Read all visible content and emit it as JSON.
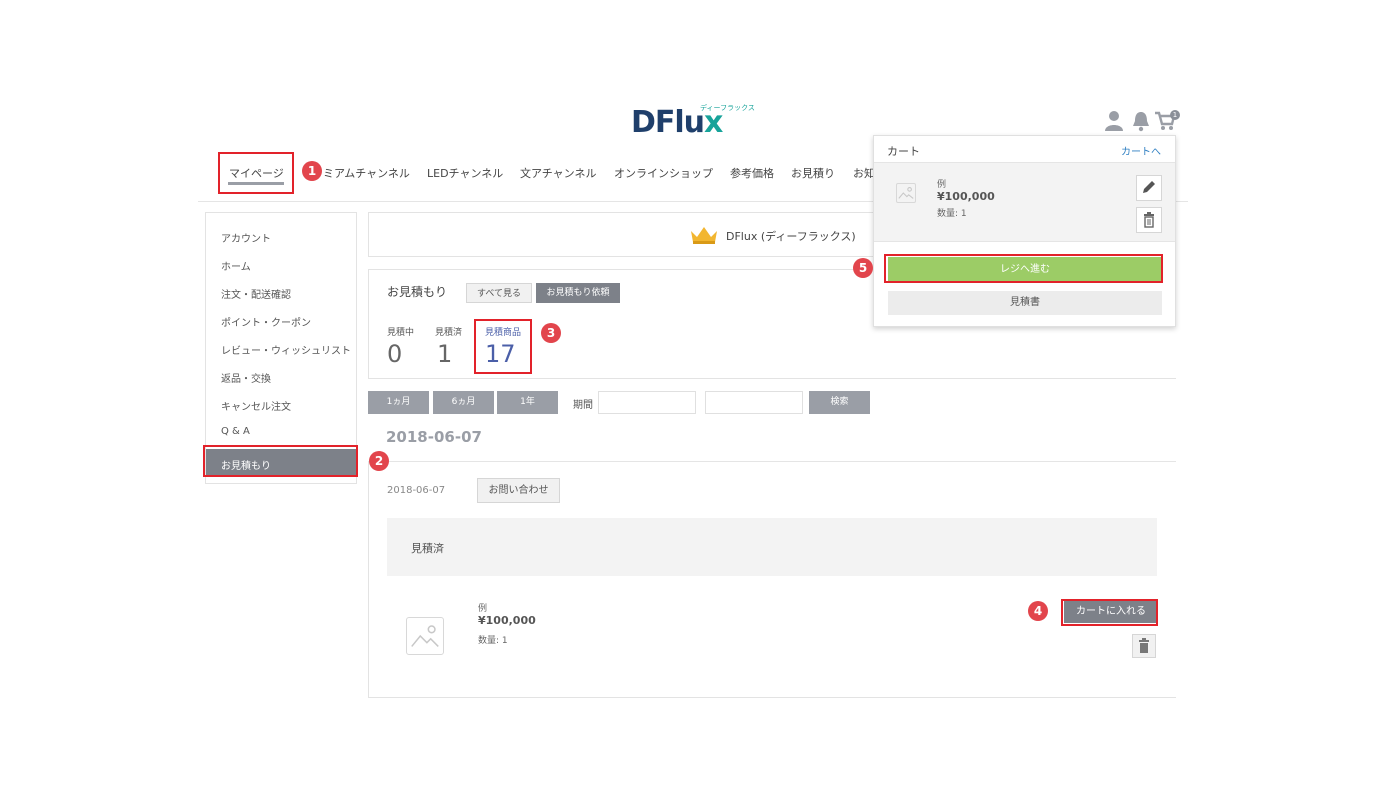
{
  "header": {
    "logo_text_main": "DFlu",
    "logo_text_x": "x",
    "logo_sub": "ディーフラックス",
    "cart_count": "1",
    "icons": [
      "user-icon",
      "bell-icon",
      "cart-icon"
    ]
  },
  "nav": {
    "items": [
      "マイページ",
      "ミアムチャンネル",
      "LEDチャンネル",
      "文アチャンネル",
      "オンラインショップ",
      "参考価格",
      "お見積り",
      "お知"
    ],
    "active": "マイページ"
  },
  "sidebar": {
    "items": [
      "アカウント",
      "ホーム",
      "注文・配送確認",
      "ポイント・クーポン",
      "レビュー・ウィッシュリスト",
      "返品・交換",
      "キャンセル注文",
      "Q & A"
    ],
    "active": "お見積もり"
  },
  "member": {
    "name": "DFlux (ディーフラックス)"
  },
  "quote": {
    "title": "お見積もり",
    "tab_all": "すべて見る",
    "tab_request": "お見積もり依頼",
    "stats": [
      {
        "label": "見積中",
        "value": "0"
      },
      {
        "label": "見積済",
        "value": "1"
      },
      {
        "label": "見積商品",
        "value": "17"
      }
    ]
  },
  "filter": {
    "btn_1m": "1ヵ月",
    "btn_6m": "6ヵ月",
    "btn_1y": "1年",
    "period_label": "期間",
    "search_btn": "検索",
    "from_value": "",
    "to_value": ""
  },
  "order": {
    "date_heading": "2018-06-07",
    "date": "2018-06-07",
    "contact_btn": "お問い合わせ",
    "status": "見積済",
    "product": {
      "name": "例",
      "price": "¥100,000",
      "qty": "数量: 1"
    },
    "add_to_cart": "カートに入れる"
  },
  "cart_dropdown": {
    "title": "カート",
    "link": "カートへ",
    "item": {
      "name": "例",
      "price": "¥100,000",
      "qty": "数量: 1"
    },
    "checkout_btn": "レジへ進む",
    "quote_btn": "見積書"
  },
  "annotations": [
    "1",
    "2",
    "3",
    "4",
    "5"
  ],
  "colors": {
    "annotation_red": "#e2222a",
    "brand_navy": "#1f3f6b",
    "brand_teal": "#17a39a",
    "checkout_green": "#9ccc66",
    "stat_blue": "#4b5fa8"
  }
}
